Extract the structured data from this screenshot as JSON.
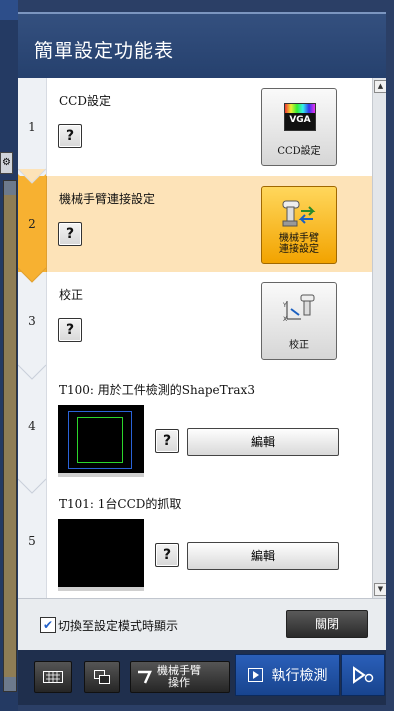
{
  "header": {
    "title": "簡單設定功能表"
  },
  "steps": [
    {
      "num": "1",
      "label": "CCD設定",
      "help": "?",
      "button_badge": "VGA",
      "button_label": "CCD設定"
    },
    {
      "num": "2",
      "label": "機械手臂連接設定",
      "help": "?",
      "button_label_line1": "機械手臂",
      "button_label_line2": "連接設定"
    },
    {
      "num": "3",
      "label": "校正",
      "help": "?",
      "button_label": "校正"
    },
    {
      "num": "4",
      "label": "T100: 用於工件檢測的ShapeTrax3",
      "help": "?",
      "edit_label": "編輯"
    },
    {
      "num": "5",
      "label": "T101: 1台CCD的抓取",
      "help": "?",
      "edit_label": "編輯"
    }
  ],
  "options": {
    "checkbox_label": "切換至設定模式時顯示",
    "checked": true,
    "close_label": "關閉"
  },
  "toolbar": {
    "robot_op_line1": "機械手臂",
    "robot_op_line2": "操作",
    "run_label": "執行檢測"
  },
  "colors": {
    "accent_active": "#f2a300",
    "header": "#2b4573",
    "run_button": "#1f4fa0"
  }
}
